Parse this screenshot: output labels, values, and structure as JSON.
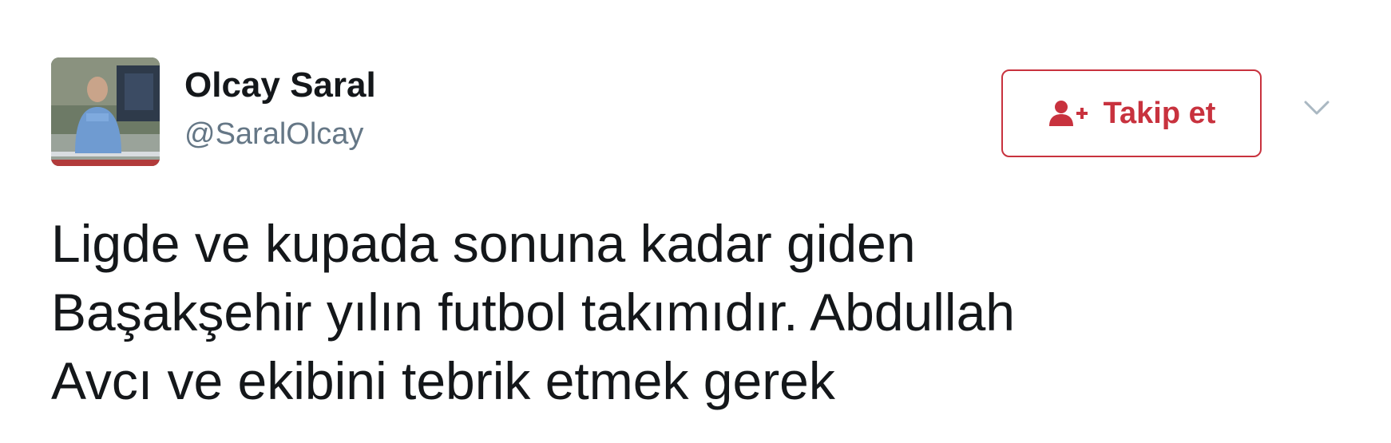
{
  "tweet": {
    "user": {
      "name": "Olcay Saral",
      "handle": "@SaralOlcay"
    },
    "follow_button": {
      "label": "Takip et",
      "icon": "add-user-icon"
    },
    "more_menu_icon": "chevron-down-icon",
    "text": "Ligde ve kupada sonuna kadar giden\nBaşakşehir yılın futbol takımıdır. Abdullah\nAvcı ve ekibini tebrik etmek gerek"
  },
  "colors": {
    "accent": "#c8323e",
    "name": "#14171a",
    "handle": "#657786",
    "chevron": "#aab8c2"
  }
}
